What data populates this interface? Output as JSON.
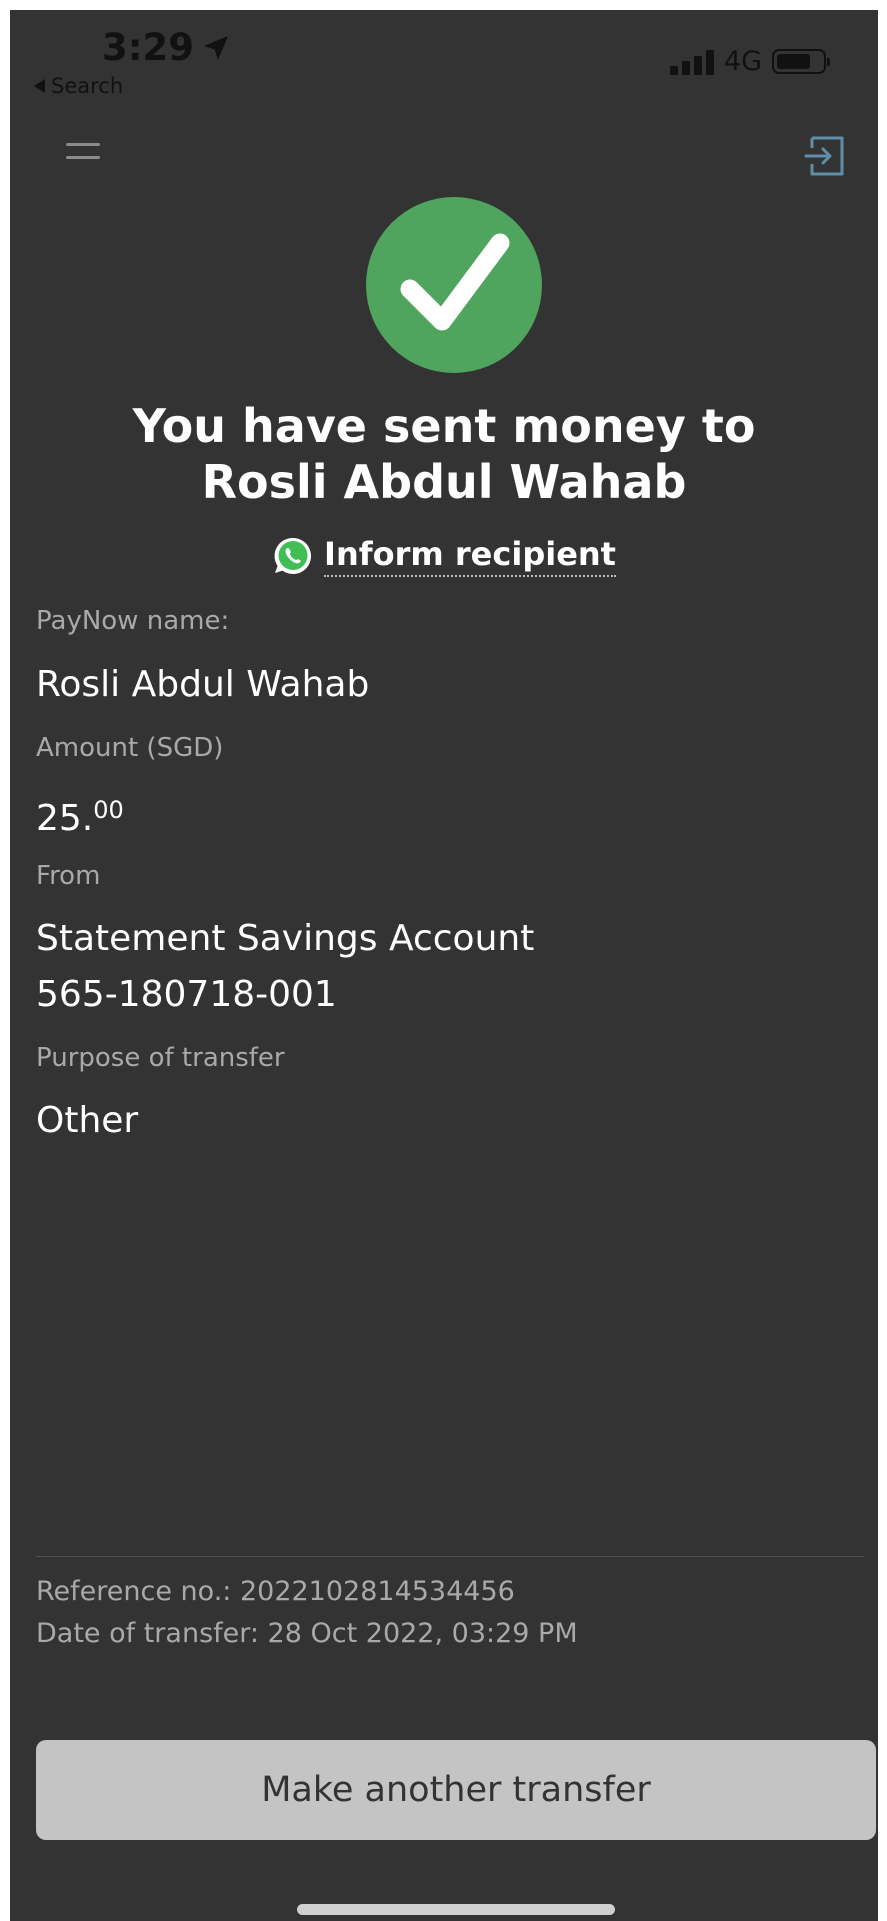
{
  "status_bar": {
    "time": "3:29",
    "back_label": "Search",
    "network": "4G",
    "signal_bars": 4,
    "battery_level": 0.75
  },
  "header": {
    "menu_icon": "hamburger-menu-icon",
    "logout_icon": "logout-icon"
  },
  "success": {
    "icon": "checkmark-icon",
    "headline": "You have sent money to Rosli Abdul Wahab",
    "inform_label": "Inform recipient",
    "inform_icon": "whatsapp-icon"
  },
  "details": {
    "paynow_label": "PayNow name:",
    "paynow_value": "Rosli Abdul Wahab",
    "amount_label": "Amount (SGD)",
    "amount_whole": "25.",
    "amount_cents": "00",
    "from_label": "From",
    "from_account_name": "Statement Savings Account",
    "from_account_number": "565-180718-001",
    "purpose_label": "Purpose of transfer",
    "purpose_value": "Other"
  },
  "footer": {
    "reference": "Reference no.: 2022102814534456",
    "date": "Date of transfer: 28 Oct 2022, 03:29 PM",
    "button_label": "Make another transfer"
  },
  "colors": {
    "background": "#333333",
    "success_green": "#4fa55d",
    "button_bg": "#c4c4c4",
    "label_grey": "#a9a9a9"
  }
}
